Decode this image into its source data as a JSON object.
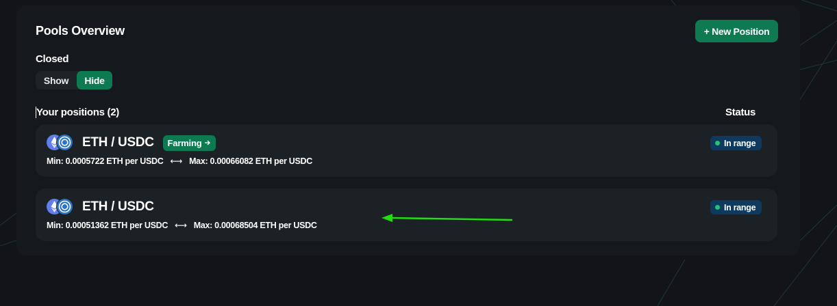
{
  "header": {
    "title": "Pools Overview",
    "new_position_label": "+ New Position"
  },
  "closed": {
    "label": "Closed",
    "show_label": "Show",
    "hide_label": "Hide",
    "selected": "Hide"
  },
  "positions": {
    "header": "Your positions (2)",
    "status_header": "Status",
    "items": [
      {
        "pair": "ETH / USDC",
        "badge": "Farming",
        "min_text": "Min: 0.0005722 ETH per USDC",
        "max_text": "Max: 0.00066082 ETH per USDC",
        "separator": "⟷",
        "status": "In range"
      },
      {
        "pair": "ETH / USDC",
        "min_text": "Min: 0.00051362 ETH per USDC",
        "max_text": "Max: 0.00068504 ETH per USDC",
        "separator": "⟷",
        "status": "In range"
      }
    ]
  },
  "colors": {
    "accent": "#0e7a52",
    "status_bg": "#0d3a5e",
    "status_dot": "#27c07a",
    "annotation_arrow": "#22dd11"
  },
  "icons": {
    "token_a": "eth-icon",
    "token_b": "usdc-icon",
    "farming_arrow": "arrow-right-icon"
  }
}
